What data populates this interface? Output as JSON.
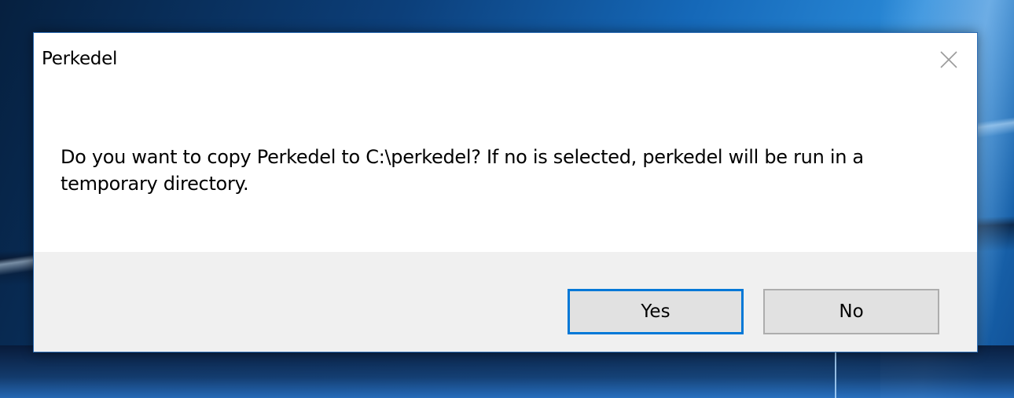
{
  "dialog": {
    "title": "Perkedel",
    "message": "Do you want to copy Perkedel to C:\\perkedel? If no is selected, perkedel will be run in a temporary directory.",
    "close_icon": "close-icon",
    "buttons": {
      "yes_label": "Yes",
      "no_label": "No"
    }
  },
  "colors": {
    "dialog_border": "#2d6cb3",
    "button_focus_border": "#0078d7",
    "button_face": "#e1e1e1",
    "button_area": "#f0f0f0"
  }
}
